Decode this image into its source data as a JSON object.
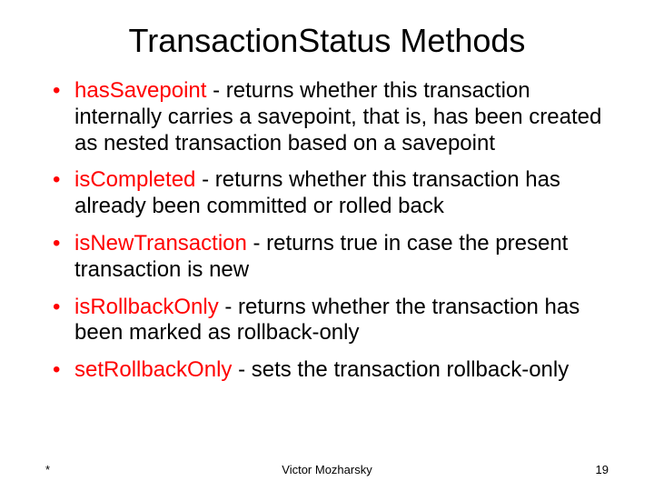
{
  "title": "TransactionStatus Methods",
  "bullets": [
    {
      "method": "hasSavepoint",
      "description": " - returns whether this transaction internally carries a savepoint, that is, has been created as nested transaction based on a savepoint"
    },
    {
      "method": "isCompleted",
      "description": " - returns whether this transaction has already been committed or rolled back"
    },
    {
      "method": "isNewTransaction",
      "description": " - returns true in case the present transaction is new"
    },
    {
      "method": "isRollbackOnly",
      "description": " - returns whether the transaction has been marked as rollback-only"
    },
    {
      "method": "setRollbackOnly",
      "description": " - sets the transaction rollback-only"
    }
  ],
  "footer": {
    "left": "*",
    "center": "Victor Mozharsky",
    "right": "19"
  }
}
